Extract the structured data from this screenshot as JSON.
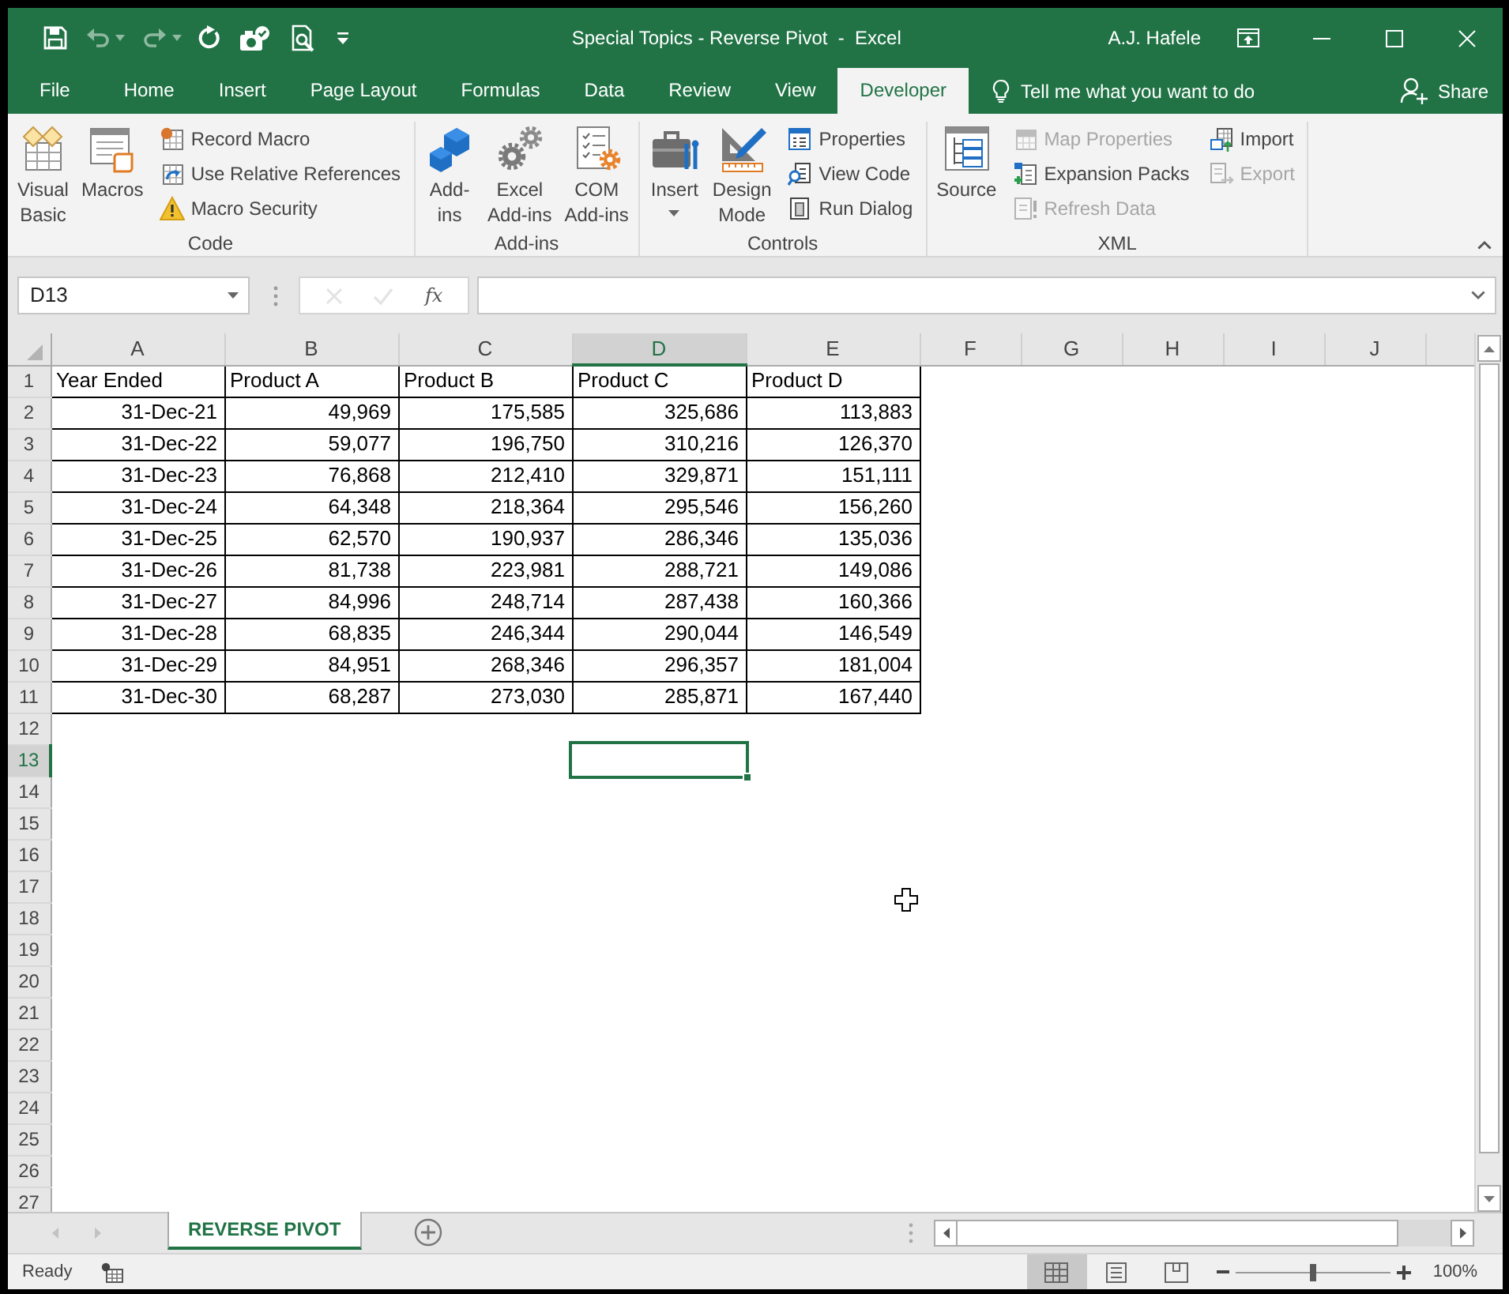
{
  "window": {
    "title": "Special Topics - Reverse Pivot  -  Excel",
    "user": "A.J. Hafele"
  },
  "quick_access": [
    {
      "disabled": false
    },
    {
      "disabled": true
    },
    {
      "disabled": true
    },
    {
      "disabled": false
    },
    {
      "disabled": false
    },
    {
      "disabled": false
    },
    {
      "disabled": false
    }
  ],
  "ribbon_tabs": [
    {
      "label": "File",
      "selected": false
    },
    {
      "label": "Home",
      "selected": false
    },
    {
      "label": "Insert",
      "selected": false
    },
    {
      "label": "Page Layout",
      "selected": false
    },
    {
      "label": "Formulas",
      "selected": false
    },
    {
      "label": "Data",
      "selected": false
    },
    {
      "label": "Review",
      "selected": false
    },
    {
      "label": "View",
      "selected": false
    },
    {
      "label": "Developer",
      "selected": true
    }
  ],
  "tell_me": "Tell me what you want to do",
  "share": "Share",
  "ribbon": [
    {
      "label": "Code",
      "items": [
        {
          "kind": "large",
          "label": "Visual\nBasic",
          "disabled": false
        },
        {
          "kind": "large",
          "label": "Macros",
          "disabled": false
        },
        {
          "kind": "stack",
          "items": [
            {
              "label": "Record Macro",
              "disabled": false
            },
            {
              "label": "Use Relative References",
              "disabled": false
            },
            {
              "label": "Macro Security",
              "disabled": false
            }
          ]
        }
      ]
    },
    {
      "label": "Add-ins",
      "items": [
        {
          "kind": "large",
          "label": "Add-\nins",
          "disabled": false
        },
        {
          "kind": "large",
          "label": "Excel\nAdd-ins",
          "disabled": false
        },
        {
          "kind": "large",
          "label": "COM\nAdd-ins",
          "disabled": false
        }
      ]
    },
    {
      "label": "Controls",
      "items": [
        {
          "kind": "menu",
          "label": "Insert",
          "disabled": false
        },
        {
          "kind": "large",
          "label": "Design\nMode",
          "disabled": false
        },
        {
          "kind": "stack",
          "items": [
            {
              "label": "Properties",
              "disabled": false
            },
            {
              "label": "View Code",
              "disabled": false
            },
            {
              "label": "Run Dialog",
              "disabled": false
            }
          ]
        }
      ]
    },
    {
      "label": "XML",
      "items": [
        {
          "kind": "large",
          "label": "Source",
          "disabled": false
        },
        {
          "kind": "stack",
          "items": [
            {
              "label": "Map Properties",
              "disabled": true
            },
            {
              "label": "Expansion Packs",
              "disabled": false
            },
            {
              "label": "Refresh Data",
              "disabled": true
            }
          ]
        },
        {
          "kind": "stack",
          "items": [
            {
              "label": "Import",
              "disabled": false
            },
            {
              "label": "Export",
              "disabled": true
            }
          ]
        }
      ]
    }
  ],
  "formula_bar": {
    "name_box": "D13",
    "buttons": [
      {
        "disabled": true
      },
      {
        "disabled": true
      },
      {
        "label": "fx",
        "disabled": false
      }
    ]
  },
  "sheet": {
    "columns": [
      {
        "label": "A",
        "selected": false
      },
      {
        "label": "B",
        "selected": false
      },
      {
        "label": "C",
        "selected": false
      },
      {
        "label": "D",
        "selected": true
      },
      {
        "label": "E",
        "selected": false
      },
      {
        "label": "F",
        "selected": false
      },
      {
        "label": "G",
        "selected": false
      },
      {
        "label": "H",
        "selected": false
      },
      {
        "label": "I",
        "selected": false
      },
      {
        "label": "J",
        "selected": false
      }
    ],
    "rows": [
      {
        "label": "1",
        "selected": false
      },
      {
        "label": "2",
        "selected": false
      },
      {
        "label": "3",
        "selected": false
      },
      {
        "label": "4",
        "selected": false
      },
      {
        "label": "5",
        "selected": false
      },
      {
        "label": "6",
        "selected": false
      },
      {
        "label": "7",
        "selected": false
      },
      {
        "label": "8",
        "selected": false
      },
      {
        "label": "9",
        "selected": false
      },
      {
        "label": "10",
        "selected": false
      },
      {
        "label": "11",
        "selected": false
      },
      {
        "label": "12",
        "selected": false
      },
      {
        "label": "13",
        "selected": true
      },
      {
        "label": "14",
        "selected": false
      },
      {
        "label": "15",
        "selected": false
      },
      {
        "label": "16",
        "selected": false
      },
      {
        "label": "17",
        "selected": false
      },
      {
        "label": "18",
        "selected": false
      },
      {
        "label": "19",
        "selected": false
      },
      {
        "label": "20",
        "selected": false
      },
      {
        "label": "21",
        "selected": false
      },
      {
        "label": "22",
        "selected": false
      },
      {
        "label": "23",
        "selected": false
      },
      {
        "label": "24",
        "selected": false
      },
      {
        "label": "25",
        "selected": false
      },
      {
        "label": "26",
        "selected": false
      },
      {
        "label": "27",
        "selected": false
      }
    ],
    "header": [
      "Year Ended",
      "Product A",
      "Product B",
      "Product C",
      "Product D"
    ],
    "data": [
      [
        "31-Dec-21",
        "49,969",
        "175,585",
        "325,686",
        "113,883"
      ],
      [
        "31-Dec-22",
        "59,077",
        "196,750",
        "310,216",
        "126,370"
      ],
      [
        "31-Dec-23",
        "76,868",
        "212,410",
        "329,871",
        "151,111"
      ],
      [
        "31-Dec-24",
        "64,348",
        "218,364",
        "295,546",
        "156,260"
      ],
      [
        "31-Dec-25",
        "62,570",
        "190,937",
        "286,346",
        "135,036"
      ],
      [
        "31-Dec-26",
        "81,738",
        "223,981",
        "288,721",
        "149,086"
      ],
      [
        "31-Dec-27",
        "84,996",
        "248,714",
        "287,438",
        "160,366"
      ],
      [
        "31-Dec-28",
        "68,835",
        "246,344",
        "290,044",
        "146,549"
      ],
      [
        "31-Dec-29",
        "84,951",
        "268,346",
        "296,357",
        "181,004"
      ],
      [
        "31-Dec-30",
        "68,287",
        "273,030",
        "285,871",
        "167,440"
      ]
    ]
  },
  "sheet_nav": [
    {
      "disabled": true
    },
    {
      "disabled": true
    }
  ],
  "sheet_tabs": [
    {
      "label": "REVERSE PIVOT",
      "selected": true
    }
  ],
  "status_bar": {
    "status": "Ready",
    "views": [
      {
        "selected": true
      },
      {
        "selected": false
      },
      {
        "selected": false
      }
    ],
    "zoom": {
      "level": 0.5,
      "reading": "100%"
    }
  }
}
